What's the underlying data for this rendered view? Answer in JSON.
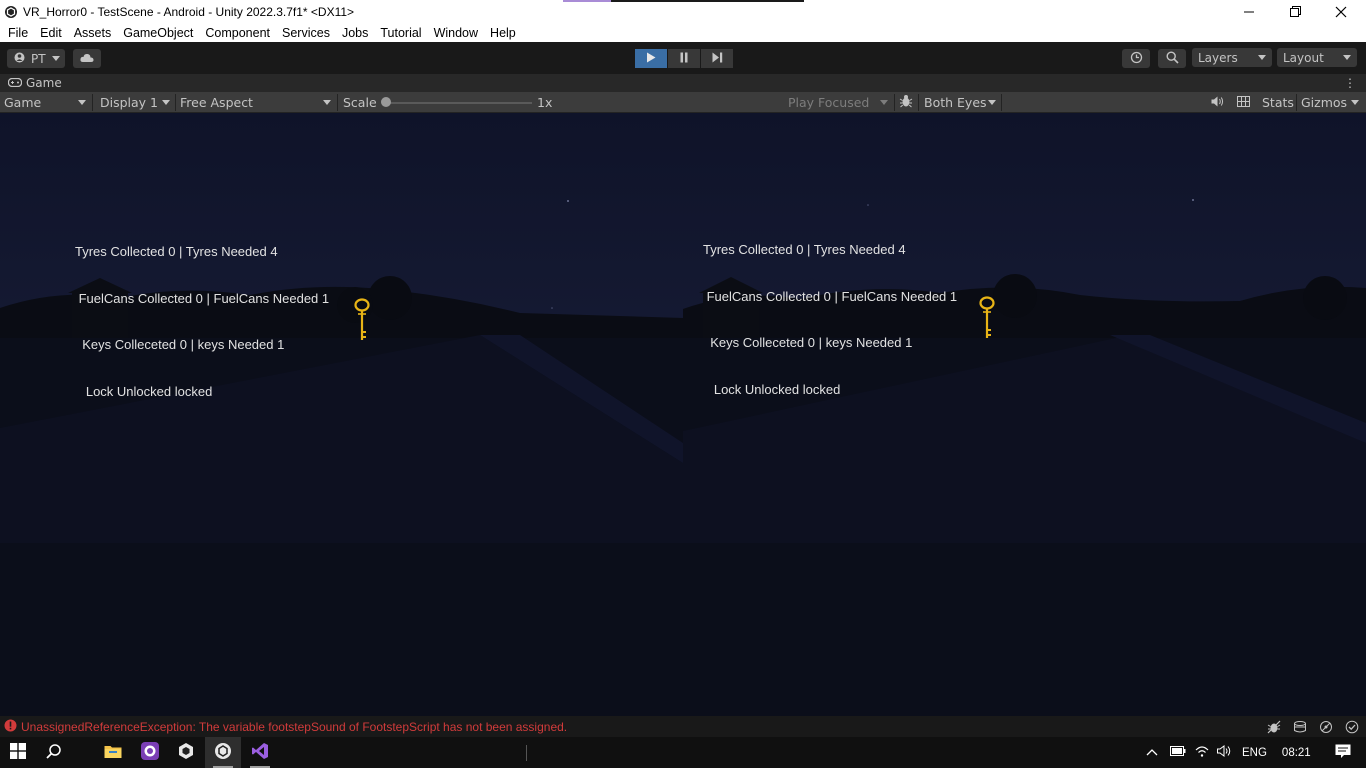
{
  "window": {
    "title": "VR_Horror0 - TestScene - Android - Unity 2022.3.7f1* <DX11>"
  },
  "menu": [
    "File",
    "Edit",
    "Assets",
    "GameObject",
    "Component",
    "Services",
    "Jobs",
    "Tutorial",
    "Window",
    "Help"
  ],
  "toolbar": {
    "account_label": "PT",
    "layers_label": "Layers",
    "layout_label": "Layout"
  },
  "panel": {
    "tab_label": "Game"
  },
  "game_toolbar": {
    "mode": "Game",
    "display": "Display 1",
    "aspect": "Free Aspect",
    "scale_label": "Scale",
    "scale_value": "1x",
    "scale_level": 0,
    "play_focus": "Play Focused",
    "eyes": "Both Eyes",
    "stats": "Stats",
    "gizmos": "Gizmos"
  },
  "hud": {
    "line1": "Tyres Collected 0 | Tyres Needed 4",
    "line2": " FuelCans Collected 0 | FuelCans Needed 1",
    "line3": "  Keys Colleceted 0 | keys Needed 1",
    "line4": "   Lock Unlocked locked"
  },
  "console": {
    "error": "UnassignedReferenceException: The variable footstepSound of FootstepScript has not been assigned."
  },
  "taskbar": {
    "language": "ENG",
    "time": "08:21"
  },
  "colors": {
    "play_active": "#3a6ea5",
    "error_red": "#d13b3b",
    "key_gold": "#e8b416",
    "sky": "#111631"
  }
}
